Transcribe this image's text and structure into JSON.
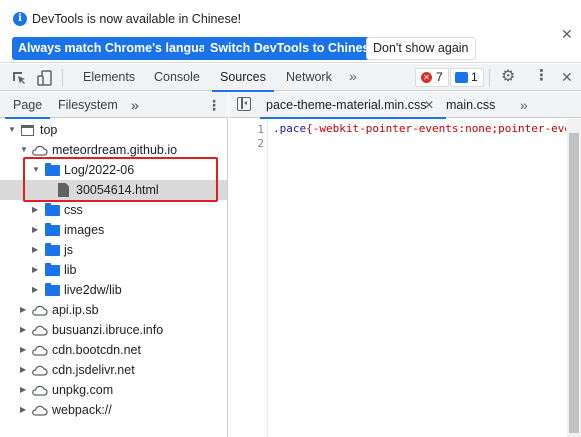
{
  "infobar": {
    "message": "DevTools is now available in Chinese!",
    "btn_match": "Always match Chrome's language",
    "btn_switch": "Switch DevTools to Chinese",
    "btn_dismiss": "Don't show again",
    "close": "✕"
  },
  "toolbar": {
    "tabs": [
      "Elements",
      "Console",
      "Sources",
      "Network"
    ],
    "active_tab": "Sources",
    "more": "»",
    "error_count": "7",
    "message_count": "1",
    "close": "✕"
  },
  "navigator": {
    "tabs": [
      "Page",
      "Filesystem"
    ],
    "more": "»",
    "menu": "⋮",
    "tree": [
      {
        "label": "top",
        "icon": "frame-icon",
        "expanded": true
      },
      {
        "label": "meteordream.github.io",
        "icon": "cloud-icon",
        "expanded": true
      },
      {
        "label": "Log/2022-06",
        "icon": "folder-icon",
        "expanded": true
      },
      {
        "label": "30054614.html",
        "icon": "file-icon",
        "selected": true
      },
      {
        "label": "css",
        "icon": "folder-icon"
      },
      {
        "label": "images",
        "icon": "folder-icon"
      },
      {
        "label": "js",
        "icon": "folder-icon"
      },
      {
        "label": "lib",
        "icon": "folder-icon"
      },
      {
        "label": "live2dw/lib",
        "icon": "folder-icon"
      },
      {
        "label": "api.ip.sb",
        "icon": "cloud-icon"
      },
      {
        "label": "busuanzi.ibruce.info",
        "icon": "cloud-icon"
      },
      {
        "label": "cdn.bootcdn.net",
        "icon": "cloud-icon"
      },
      {
        "label": "cdn.jsdelivr.net",
        "icon": "cloud-icon"
      },
      {
        "label": "unpkg.com",
        "icon": "cloud-icon"
      },
      {
        "label": "webpack://",
        "icon": "cloud-icon"
      }
    ]
  },
  "editor": {
    "tabs": [
      "pace-theme-material.min.css",
      "main.css"
    ],
    "tab_close": "✕",
    "more": "»",
    "line_numbers": [
      "1",
      "2"
    ],
    "code_selector": ".pace",
    "code_rest": "{-webkit-pointer-events:none;pointer-eve"
  },
  "colors": {
    "accent": "#1a73e8",
    "highlight_box": "#e02020",
    "error": "#d93025"
  }
}
